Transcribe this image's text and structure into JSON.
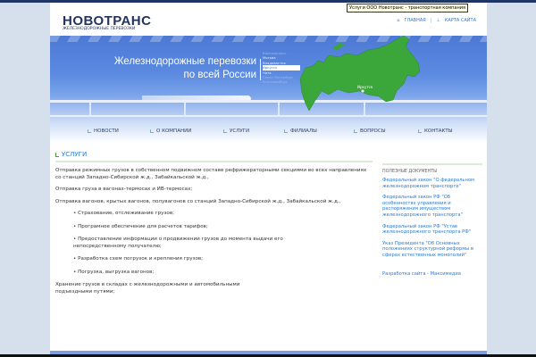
{
  "tooltip": "Услуги ООО Новотранс - транспортная компания",
  "logo": {
    "name": "НОВОТРАНС",
    "subtitle": "ЖЕЛЕЗНОДОРОЖНЫЕ ПЕРЕВОЗКИ"
  },
  "toplinks": {
    "home": "ГЛАВНАЯ",
    "sitemap": "КАРТА САЙТА",
    "separator": "|"
  },
  "banner": {
    "slogan_line1": "Железнодорожные перевозки",
    "slogan_line2": "по всей России",
    "cities": [
      "Комсомольск",
      "Москва",
      "Владивосток",
      "Иркутск",
      "Чита",
      "Санкт-Петербург",
      "Екатеринбург"
    ],
    "map_label": "Иркутск"
  },
  "nav": [
    "НОВОСТИ",
    "О КОМПАНИИ",
    "УСЛУГИ",
    "ФИЛИАЛЫ",
    "ВОПРОСЫ",
    "КОНТАКТЫ"
  ],
  "main": {
    "title": "УСЛУГИ",
    "p1": "Отправка режимных грузов в собственном подвижном составе рефрижераторными секциями во всех направлениях со станций Западно-Сибирской ж.д., Забайкальской ж.д.,",
    "p2": "Отправка груза в вагонах-термосах и ИВ-термосах;",
    "p3": "Отправка вагонов, крытых вагонов, полувагонов со станций Западно-Сибирской ж.д., Забайкальской ж.д.,",
    "list": [
      "• Страхование, отслеживание грузов;",
      "• Програмное обеспечение для расчетов тарифов;",
      "• Предоставление информации о продвижении грузов до момента выдачи его непосредственному получателю;",
      "• Разработка схем погрузок и крепления грузов;",
      "• Погрузка, выгрузка вагонов;"
    ],
    "p4": "Хранение грузов в складах с железнодорожными и автомобильными подъездными путями;"
  },
  "sidebar": {
    "heading": "ПОЛЕЗНЫЕ ДОКУМЕНТЫ",
    "links": [
      "Федеральный закон \"О федеральном железнодорожном транспорте\"",
      "Федеральный закон РФ \"Об особенностях управления и распоряжения имуществом железнодорожного транспорта\"",
      "Федеральный закон РФ \"Устав железнодорожного транспорта РФ\"",
      "Указ Президента \"Об Основных положениях структурной реформы в сферах естественных монополий\""
    ],
    "developer": "Разработка сайта - Максимедиа"
  }
}
